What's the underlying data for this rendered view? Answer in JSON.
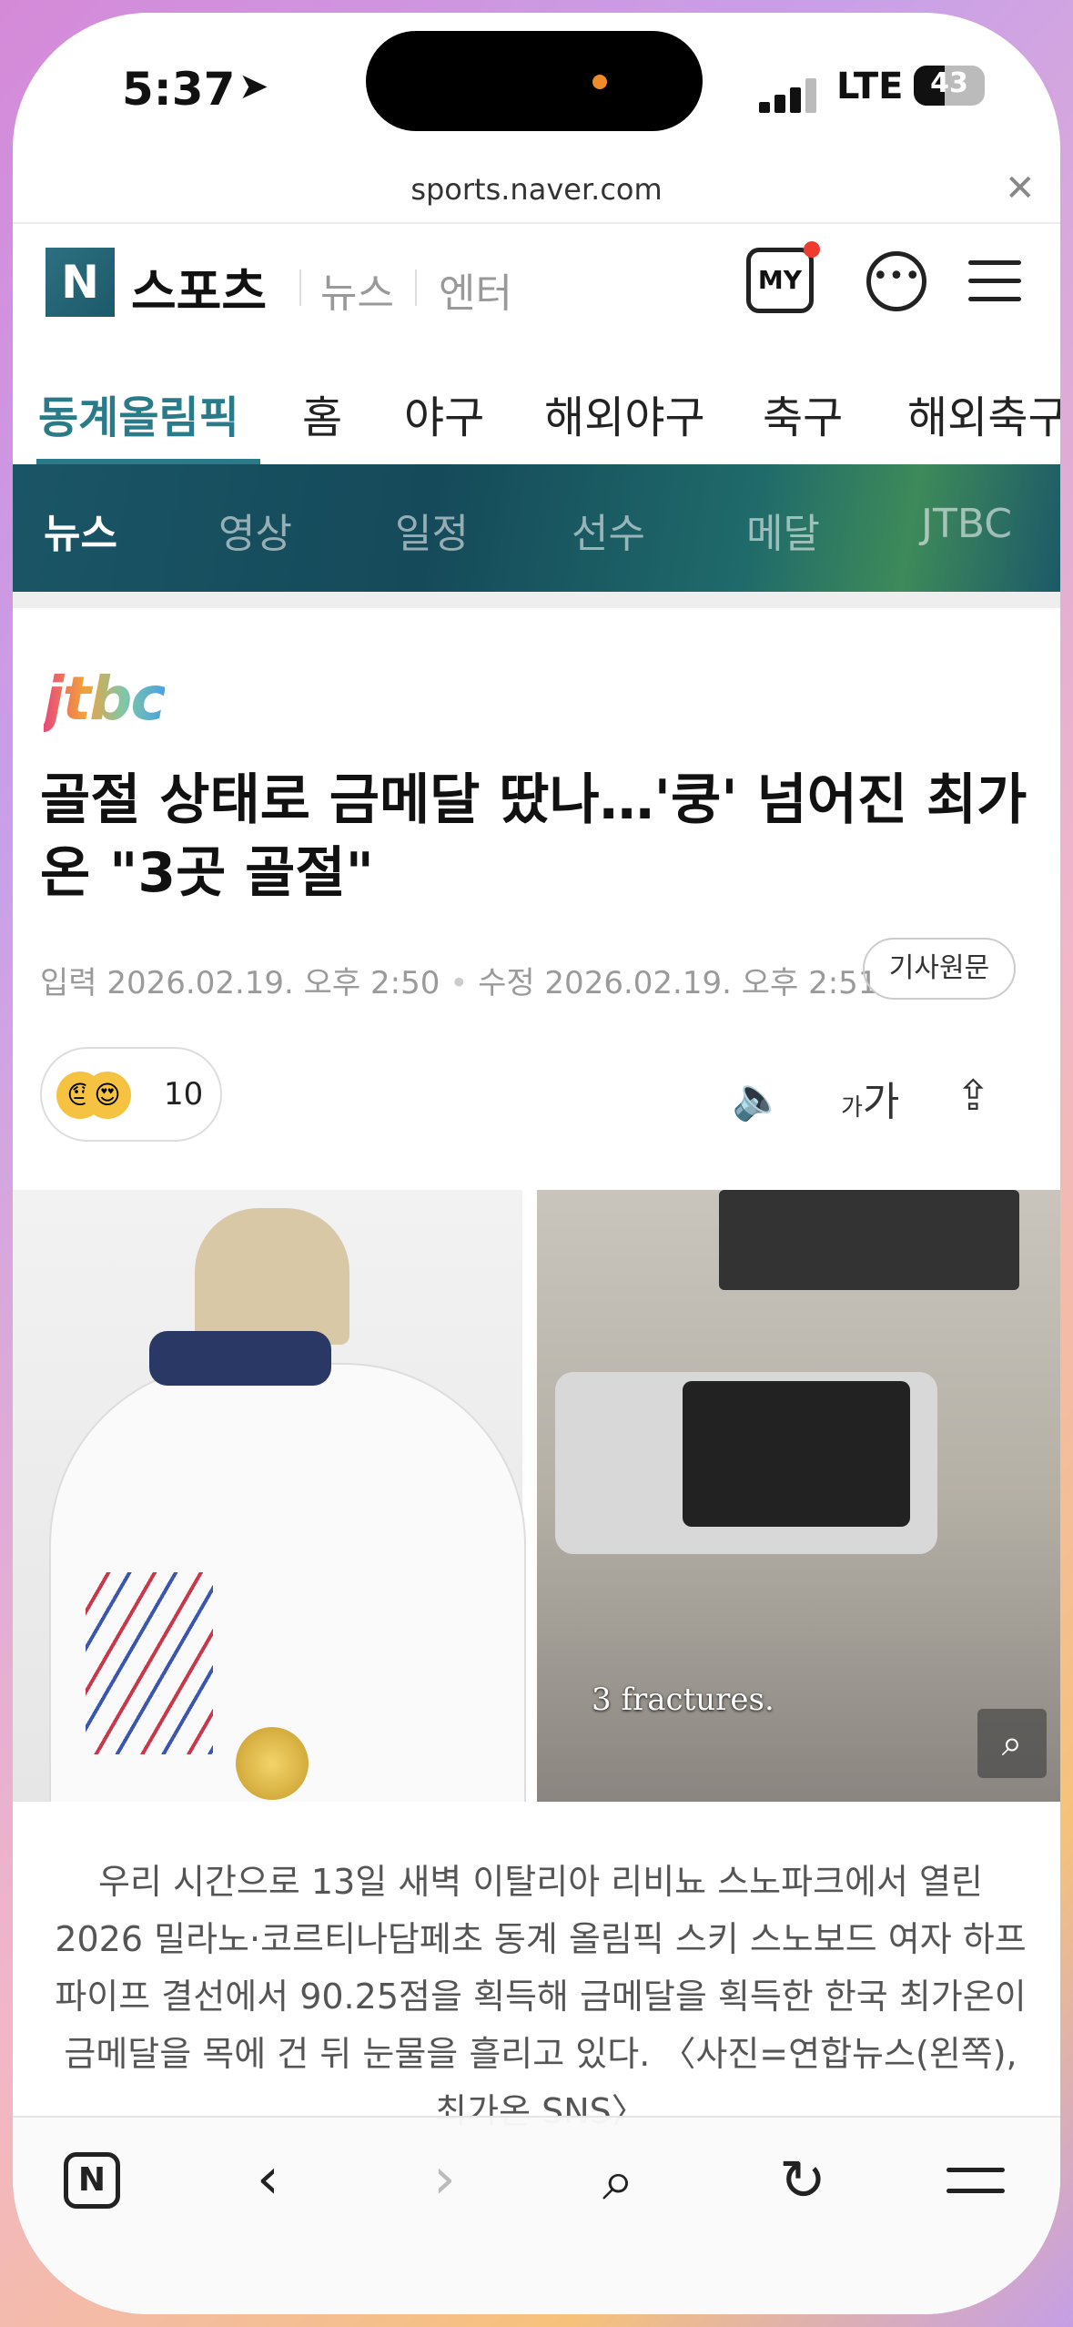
{
  "status": {
    "time": "5:37",
    "network": "LTE",
    "battery": "43"
  },
  "browser": {
    "url": "sports.naver.com"
  },
  "header": {
    "logo": "N",
    "brand": "스포츠",
    "news": "뉴스",
    "entertainment": "엔터",
    "my": "MY"
  },
  "sport_tabs": [
    "동계올림픽",
    "홈",
    "야구",
    "해외야구",
    "축구",
    "해외축구"
  ],
  "sub_tabs": [
    "뉴스",
    "영상",
    "일정",
    "선수",
    "메달",
    "JTBC"
  ],
  "article": {
    "publisher": "jtbc",
    "title": "골절 상태로 금메달 땄나…'쿵' 넘어진 최가온 \"3곳 골절\"",
    "published": "입력 2026.02.19. 오후 2:50",
    "modified": "수정 2026.02.19. 오후 2:51",
    "original_button": "기사원문",
    "reaction_count": "10",
    "font_small": "가",
    "font_big": "가",
    "image_caption_overlay": "3 fractures.",
    "caption": "우리 시간으로 13일 새벽 이탈리아 리비뇨 스노파크에서 열린 2026 밀라노·코르티나담페초 동계 올림픽 스키 스노보드 여자 하프파이프 결선에서 90.25점을 획득해 금메달을 획득한 한국 최가온이 금메달을 목에 건 뒤 눈물을 흘리고 있다. 〈사진=연합뉴스(왼쪽), 최가온 SNS〉"
  },
  "toolbar": {
    "home": "N"
  },
  "colors": {
    "accent": "#2a7b8a",
    "notify": "#ee3b2f"
  }
}
